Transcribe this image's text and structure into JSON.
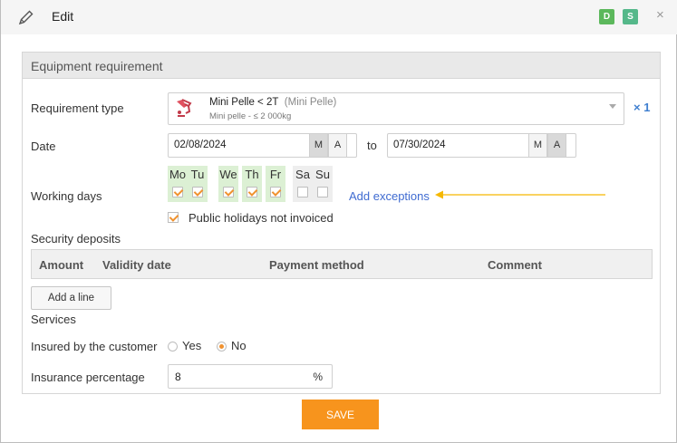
{
  "header": {
    "title": "Edit",
    "badge_d": "D",
    "badge_s": "S",
    "close": "×"
  },
  "panel": {
    "title": "Equipment requirement"
  },
  "requirement": {
    "label": "Requirement type",
    "name": "Mini Pelle < 2T",
    "category": "(Mini Pelle)",
    "detail": "Mini pelle - ≤ 2 000kg",
    "quantity": "× 1"
  },
  "date": {
    "label": "Date",
    "start": "02/08/2024",
    "end": "07/30/2024",
    "to": "to",
    "m": "M",
    "a": "A"
  },
  "working_days": {
    "label": "Working days",
    "days": [
      {
        "name": "Mo",
        "checked": true
      },
      {
        "name": "Tu",
        "checked": true
      },
      {
        "name": "We",
        "checked": true
      },
      {
        "name": "Th",
        "checked": true
      },
      {
        "name": "Fr",
        "checked": true
      },
      {
        "name": "Sa",
        "checked": false
      },
      {
        "name": "Su",
        "checked": false
      }
    ],
    "add_exceptions": "Add exceptions",
    "holidays": "Public holidays not invoiced",
    "arrow_color": "#f5b800"
  },
  "deposits": {
    "label": "Security deposits",
    "columns": [
      "Amount",
      "Validity date",
      "Payment method",
      "Comment"
    ],
    "add_line": "Add a line"
  },
  "services": {
    "label": "Services",
    "insured_label": "Insured by the customer",
    "yes": "Yes",
    "no": "No",
    "selected": "No",
    "percentage_label": "Insurance percentage",
    "percentage_value": "8",
    "percentage_unit": "%"
  },
  "actions": {
    "save": "SAVE"
  },
  "colors": {
    "accent": "#f7941d",
    "link": "#3f6bd1",
    "working_day": "#dcf0d4"
  }
}
